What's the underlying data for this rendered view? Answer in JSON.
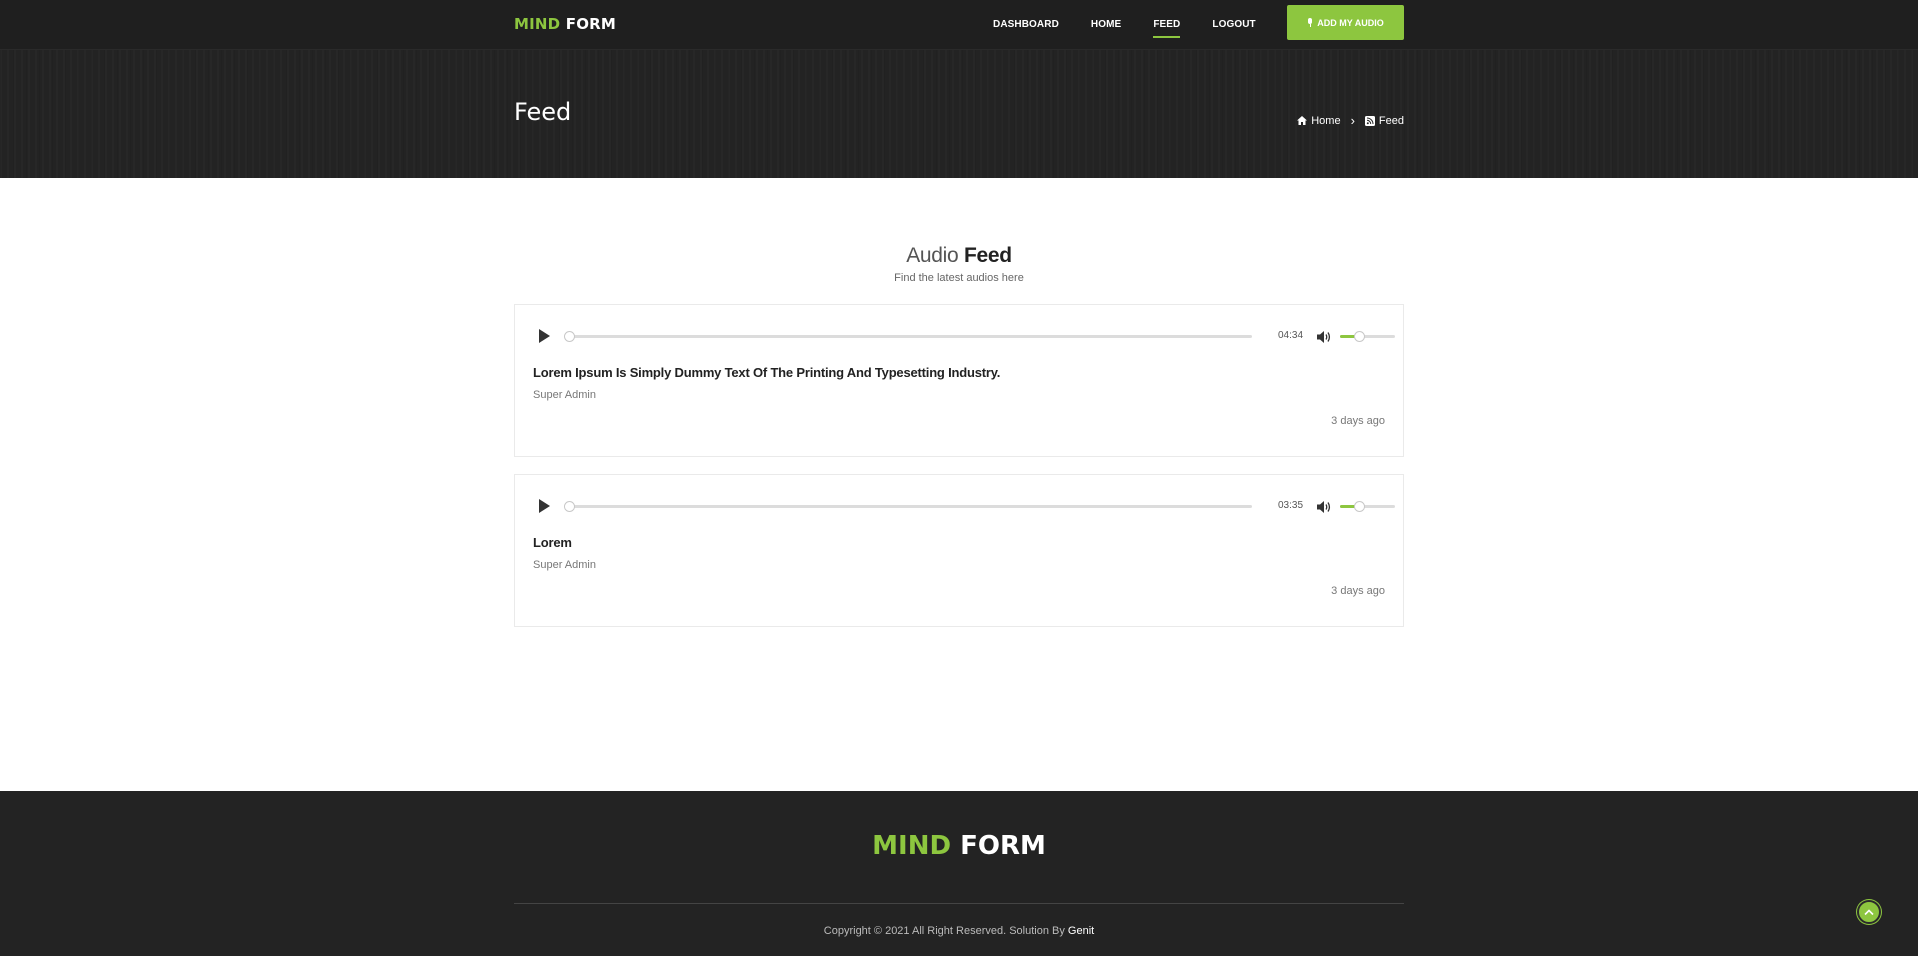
{
  "brand": {
    "logo_part1": "MIND",
    "logo_part2": "FORM"
  },
  "nav": {
    "items": [
      {
        "label": "DASHBOARD"
      },
      {
        "label": "HOME"
      },
      {
        "label": "FEED",
        "active": true
      },
      {
        "label": "LOGOUT"
      }
    ],
    "add_audio_label": "ADD MY AUDIO"
  },
  "page": {
    "title": "Feed"
  },
  "breadcrumb": {
    "home": "Home",
    "current": "Feed"
  },
  "section": {
    "title_light": "Audio",
    "title_bold": "Feed",
    "subtitle": "Find the latest audios here"
  },
  "feed": [
    {
      "duration": "04:34",
      "volume": 0.35,
      "progress": 0,
      "title": "Lorem Ipsum Is Simply Dummy Text Of The Printing And Typesetting Industry.",
      "author": "Super Admin",
      "time": "3 days ago"
    },
    {
      "duration": "03:35",
      "volume": 0.35,
      "progress": 0,
      "title": "Lorem",
      "author": "Super Admin",
      "time": "3 days ago"
    }
  ],
  "footer": {
    "logo_part1": "MIND",
    "logo_part2": "FORM",
    "copyright_text": "Copyright © 2021 All Right Reserved. Solution By",
    "copyright_brand": "Genit"
  },
  "colors": {
    "accent": "#8dc63f",
    "header_bg": "#232323",
    "footer_bg": "#232323"
  },
  "icons": [
    "mic-icon",
    "home-icon",
    "chevron-right-icon",
    "rss-icon",
    "play-icon",
    "volume-icon",
    "chevron-up-icon"
  ]
}
